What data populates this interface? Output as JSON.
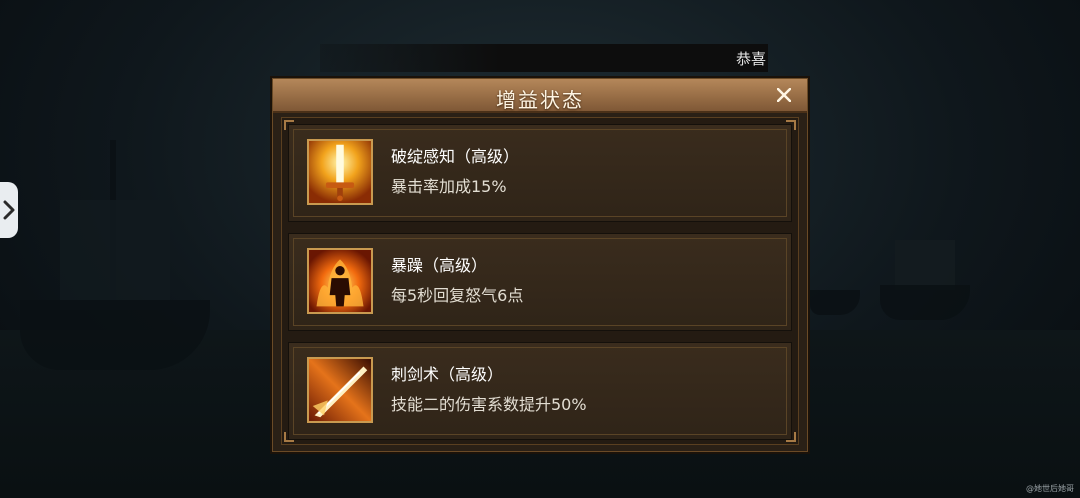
{
  "notice": {
    "text": "恭喜"
  },
  "dialog": {
    "title": "增益状态",
    "close_label": "X"
  },
  "buffs": [
    {
      "name": "破绽感知（高级）",
      "description": "暴击率加成15%",
      "icon": "golden-sword-icon"
    },
    {
      "name": "暴躁（高级）",
      "description": "每5秒回复怒气6点",
      "icon": "fiery-warrior-icon"
    },
    {
      "name": "刺剑术（高级）",
      "description": "技能二的伤害系数提升50%",
      "icon": "rapier-thrust-icon"
    }
  ],
  "watermark": "@她世后她哥"
}
